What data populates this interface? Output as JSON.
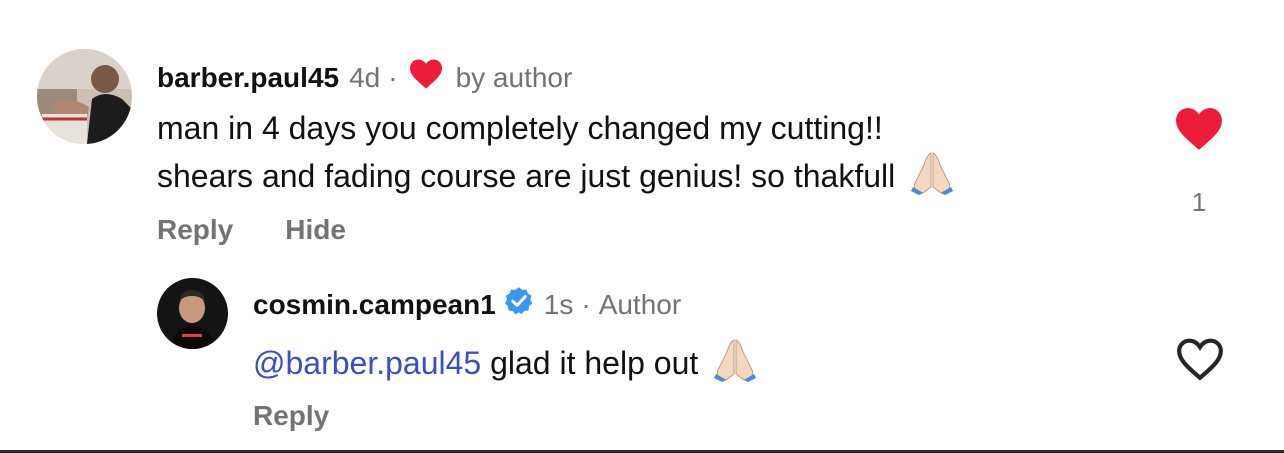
{
  "comments": [
    {
      "username": "barber.paul45",
      "time": "4d",
      "separator": "·",
      "by_author": "by author",
      "text_lines": [
        "man in 4 days you completely changed my cutting!!",
        "shears and fading course are just genius! so thakfull"
      ],
      "emoji": "folded-hands",
      "actions": {
        "reply": "Reply",
        "hide": "Hide"
      },
      "liked": true,
      "like_count": "1"
    },
    {
      "username": "cosmin.campean1",
      "verified": true,
      "time": "1s",
      "separator": "·",
      "author_label": "Author",
      "mention": "@barber.paul45",
      "text": "glad it help out",
      "emoji": "folded-hands",
      "actions": {
        "reply": "Reply"
      },
      "liked": false
    }
  ],
  "colors": {
    "heart_red": "#ed1c3a",
    "meta_grey": "#737373",
    "mention_blue": "#3b4fc4",
    "verified_blue": "#3897f0"
  },
  "icons": {
    "liked_heart": "heart-filled-icon",
    "unliked_heart": "heart-outline-icon",
    "verified": "verified-badge-icon",
    "emoji": "folded-hands-emoji"
  }
}
